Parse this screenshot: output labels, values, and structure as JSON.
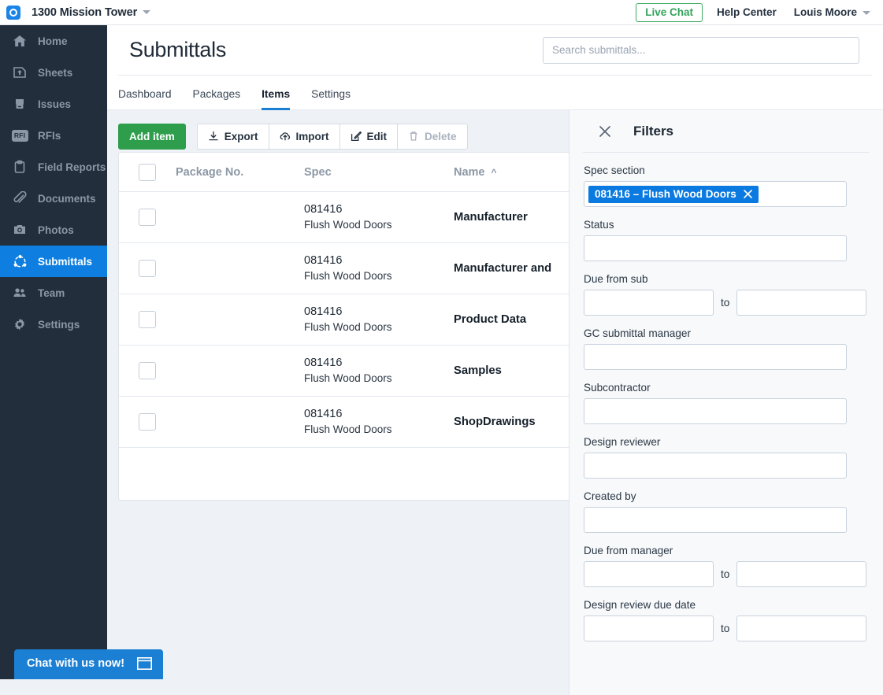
{
  "topbar": {
    "project_name": "1300 Mission Tower",
    "logo_icon": "circle-logo-icon",
    "live_chat_label": "Live Chat",
    "live_chat_color": "#35a35c",
    "help_center_label": "Help Center",
    "user_name": "Louis Moore"
  },
  "sidebar": {
    "items": [
      {
        "label": "Home",
        "icon": "home-icon",
        "active": false
      },
      {
        "label": "Sheets",
        "icon": "sheets-icon",
        "active": false
      },
      {
        "label": "Issues",
        "icon": "issues-glove-icon",
        "active": false
      },
      {
        "label": "RFIs",
        "icon": "rfi-badge-icon",
        "active": false
      },
      {
        "label": "Field Reports",
        "icon": "clipboard-icon",
        "active": false
      },
      {
        "label": "Documents",
        "icon": "paperclip-icon",
        "active": false
      },
      {
        "label": "Photos",
        "icon": "camera-icon",
        "active": false
      },
      {
        "label": "Submittals",
        "icon": "submittals-icon",
        "active": true
      },
      {
        "label": "Team",
        "icon": "team-icon",
        "active": false
      },
      {
        "label": "Settings",
        "icon": "gear-icon",
        "active": false
      }
    ],
    "active_color": "#0e7fe0",
    "background_color": "#222e3c"
  },
  "page": {
    "title": "Submittals",
    "search_placeholder": "Search submittals...",
    "tabs": [
      {
        "label": "Dashboard",
        "active": false
      },
      {
        "label": "Packages",
        "active": false
      },
      {
        "label": "Items",
        "active": true
      },
      {
        "label": "Settings",
        "active": false
      }
    ],
    "active_tab_color": "#1b7fd4"
  },
  "toolbar": {
    "add_item_label": "Add item",
    "add_item_color": "#2e9e4d",
    "export_label": "Export",
    "import_label": "Import",
    "edit_label": "Edit",
    "delete_label": "Delete"
  },
  "table": {
    "columns": {
      "package_no": "Package No.",
      "spec": "Spec",
      "name": "Name",
      "name_sort": "⌃"
    },
    "rows": [
      {
        "package_no": "",
        "spec_no": "081416",
        "spec_desc": "Flush Wood Doors",
        "name": "Manufacturer"
      },
      {
        "package_no": "",
        "spec_no": "081416",
        "spec_desc": "Flush Wood Doors",
        "name": "Manufacturer and"
      },
      {
        "package_no": "",
        "spec_no": "081416",
        "spec_desc": "Flush Wood Doors",
        "name": "Product Data"
      },
      {
        "package_no": "",
        "spec_no": "081416",
        "spec_desc": "Flush Wood Doors",
        "name": "Samples"
      },
      {
        "package_no": "",
        "spec_no": "081416",
        "spec_desc": "Flush Wood Doors",
        "name": "ShopDrawings"
      }
    ]
  },
  "filters": {
    "title": "Filters",
    "close_icon": "close-icon",
    "spec_section": {
      "label": "Spec section",
      "chip": "081416 – Flush Wood Doors",
      "chip_color": "#0b7ae0"
    },
    "status": {
      "label": "Status",
      "value": ""
    },
    "due_from_sub": {
      "label": "Due from sub",
      "from": "",
      "to_label": "to",
      "to": ""
    },
    "gc_submittal_manager": {
      "label": "GC submittal manager",
      "value": ""
    },
    "subcontractor": {
      "label": "Subcontractor",
      "value": ""
    },
    "design_reviewer": {
      "label": "Design reviewer",
      "value": ""
    },
    "created_by": {
      "label": "Created by",
      "value": ""
    },
    "due_from_manager": {
      "label": "Due from manager",
      "from": "",
      "to_label": "to",
      "to": ""
    },
    "design_review_due_date": {
      "label": "Design review due date",
      "from": "",
      "to_label": "to",
      "to": ""
    }
  },
  "chat": {
    "label": "Chat with us now!",
    "icon": "chat-window-icon",
    "color": "#1b7fd4"
  }
}
